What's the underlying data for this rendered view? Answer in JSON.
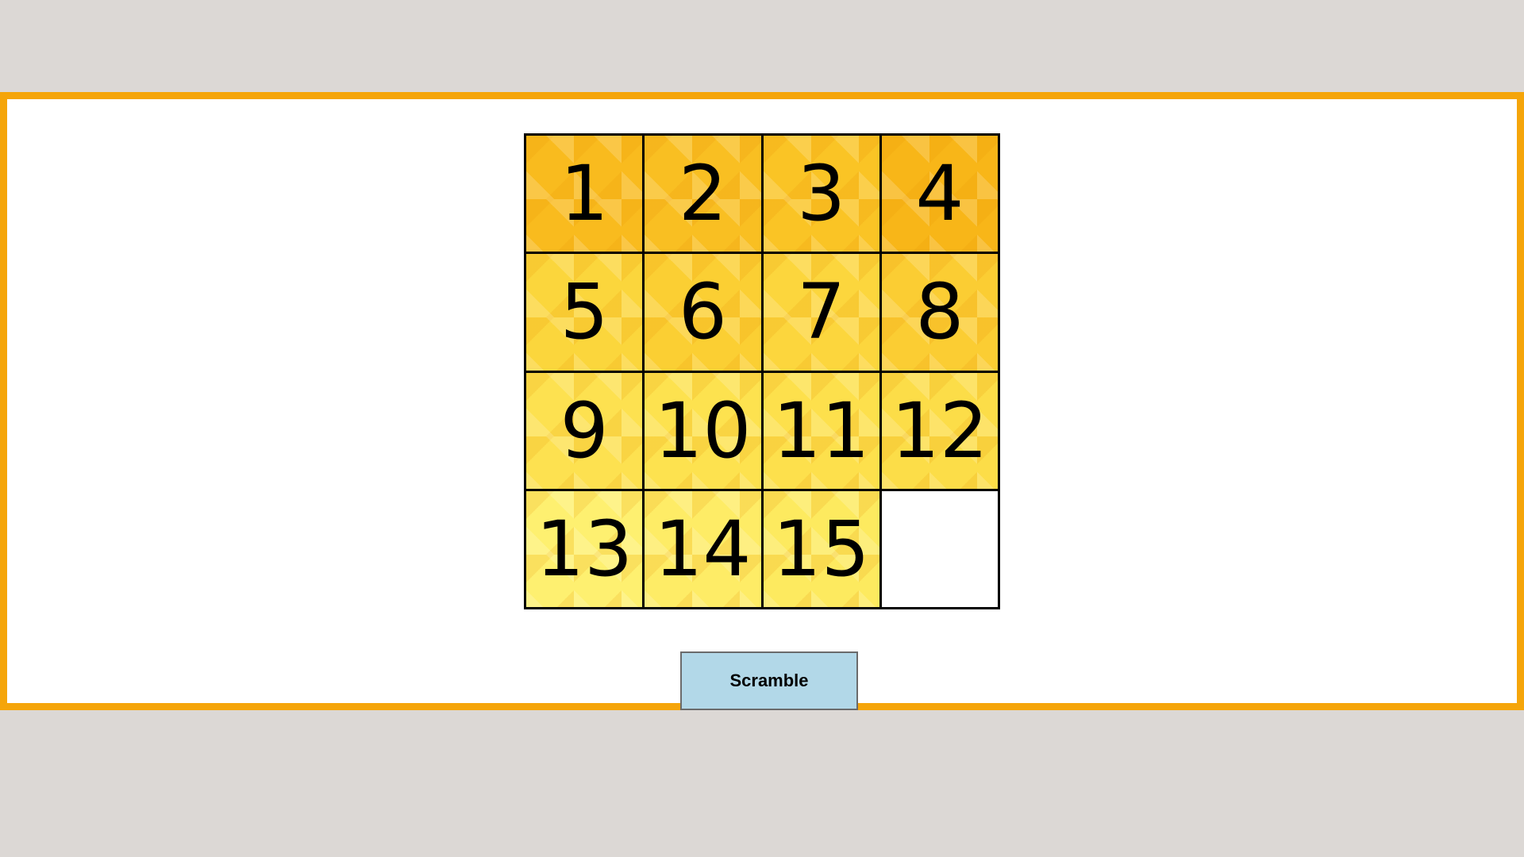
{
  "puzzle": {
    "tiles": [
      {
        "label": "1",
        "color": "#f9bb1e"
      },
      {
        "label": "2",
        "color": "#f9bf22"
      },
      {
        "label": "3",
        "color": "#fac425"
      },
      {
        "label": "4",
        "color": "#f8b618"
      },
      {
        "label": "5",
        "color": "#fbd63c"
      },
      {
        "label": "6",
        "color": "#fbcf33"
      },
      {
        "label": "7",
        "color": "#fcd63d"
      },
      {
        "label": "8",
        "color": "#fbcd33"
      },
      {
        "label": "9",
        "color": "#fde150"
      },
      {
        "label": "10",
        "color": "#fde24f"
      },
      {
        "label": "11",
        "color": "#fde04c"
      },
      {
        "label": "12",
        "color": "#fcdd48"
      },
      {
        "label": "13",
        "color": "#fef070"
      },
      {
        "label": "14",
        "color": "#feec66"
      },
      {
        "label": "15",
        "color": "#fdea5f"
      },
      {
        "label": "",
        "color": "#ffffff"
      }
    ]
  },
  "controls": {
    "scramble_label": "Scramble"
  },
  "colors": {
    "frame": "#f5a50a",
    "page_background": "#dcd8d5",
    "button_background": "#b2d8e8"
  }
}
